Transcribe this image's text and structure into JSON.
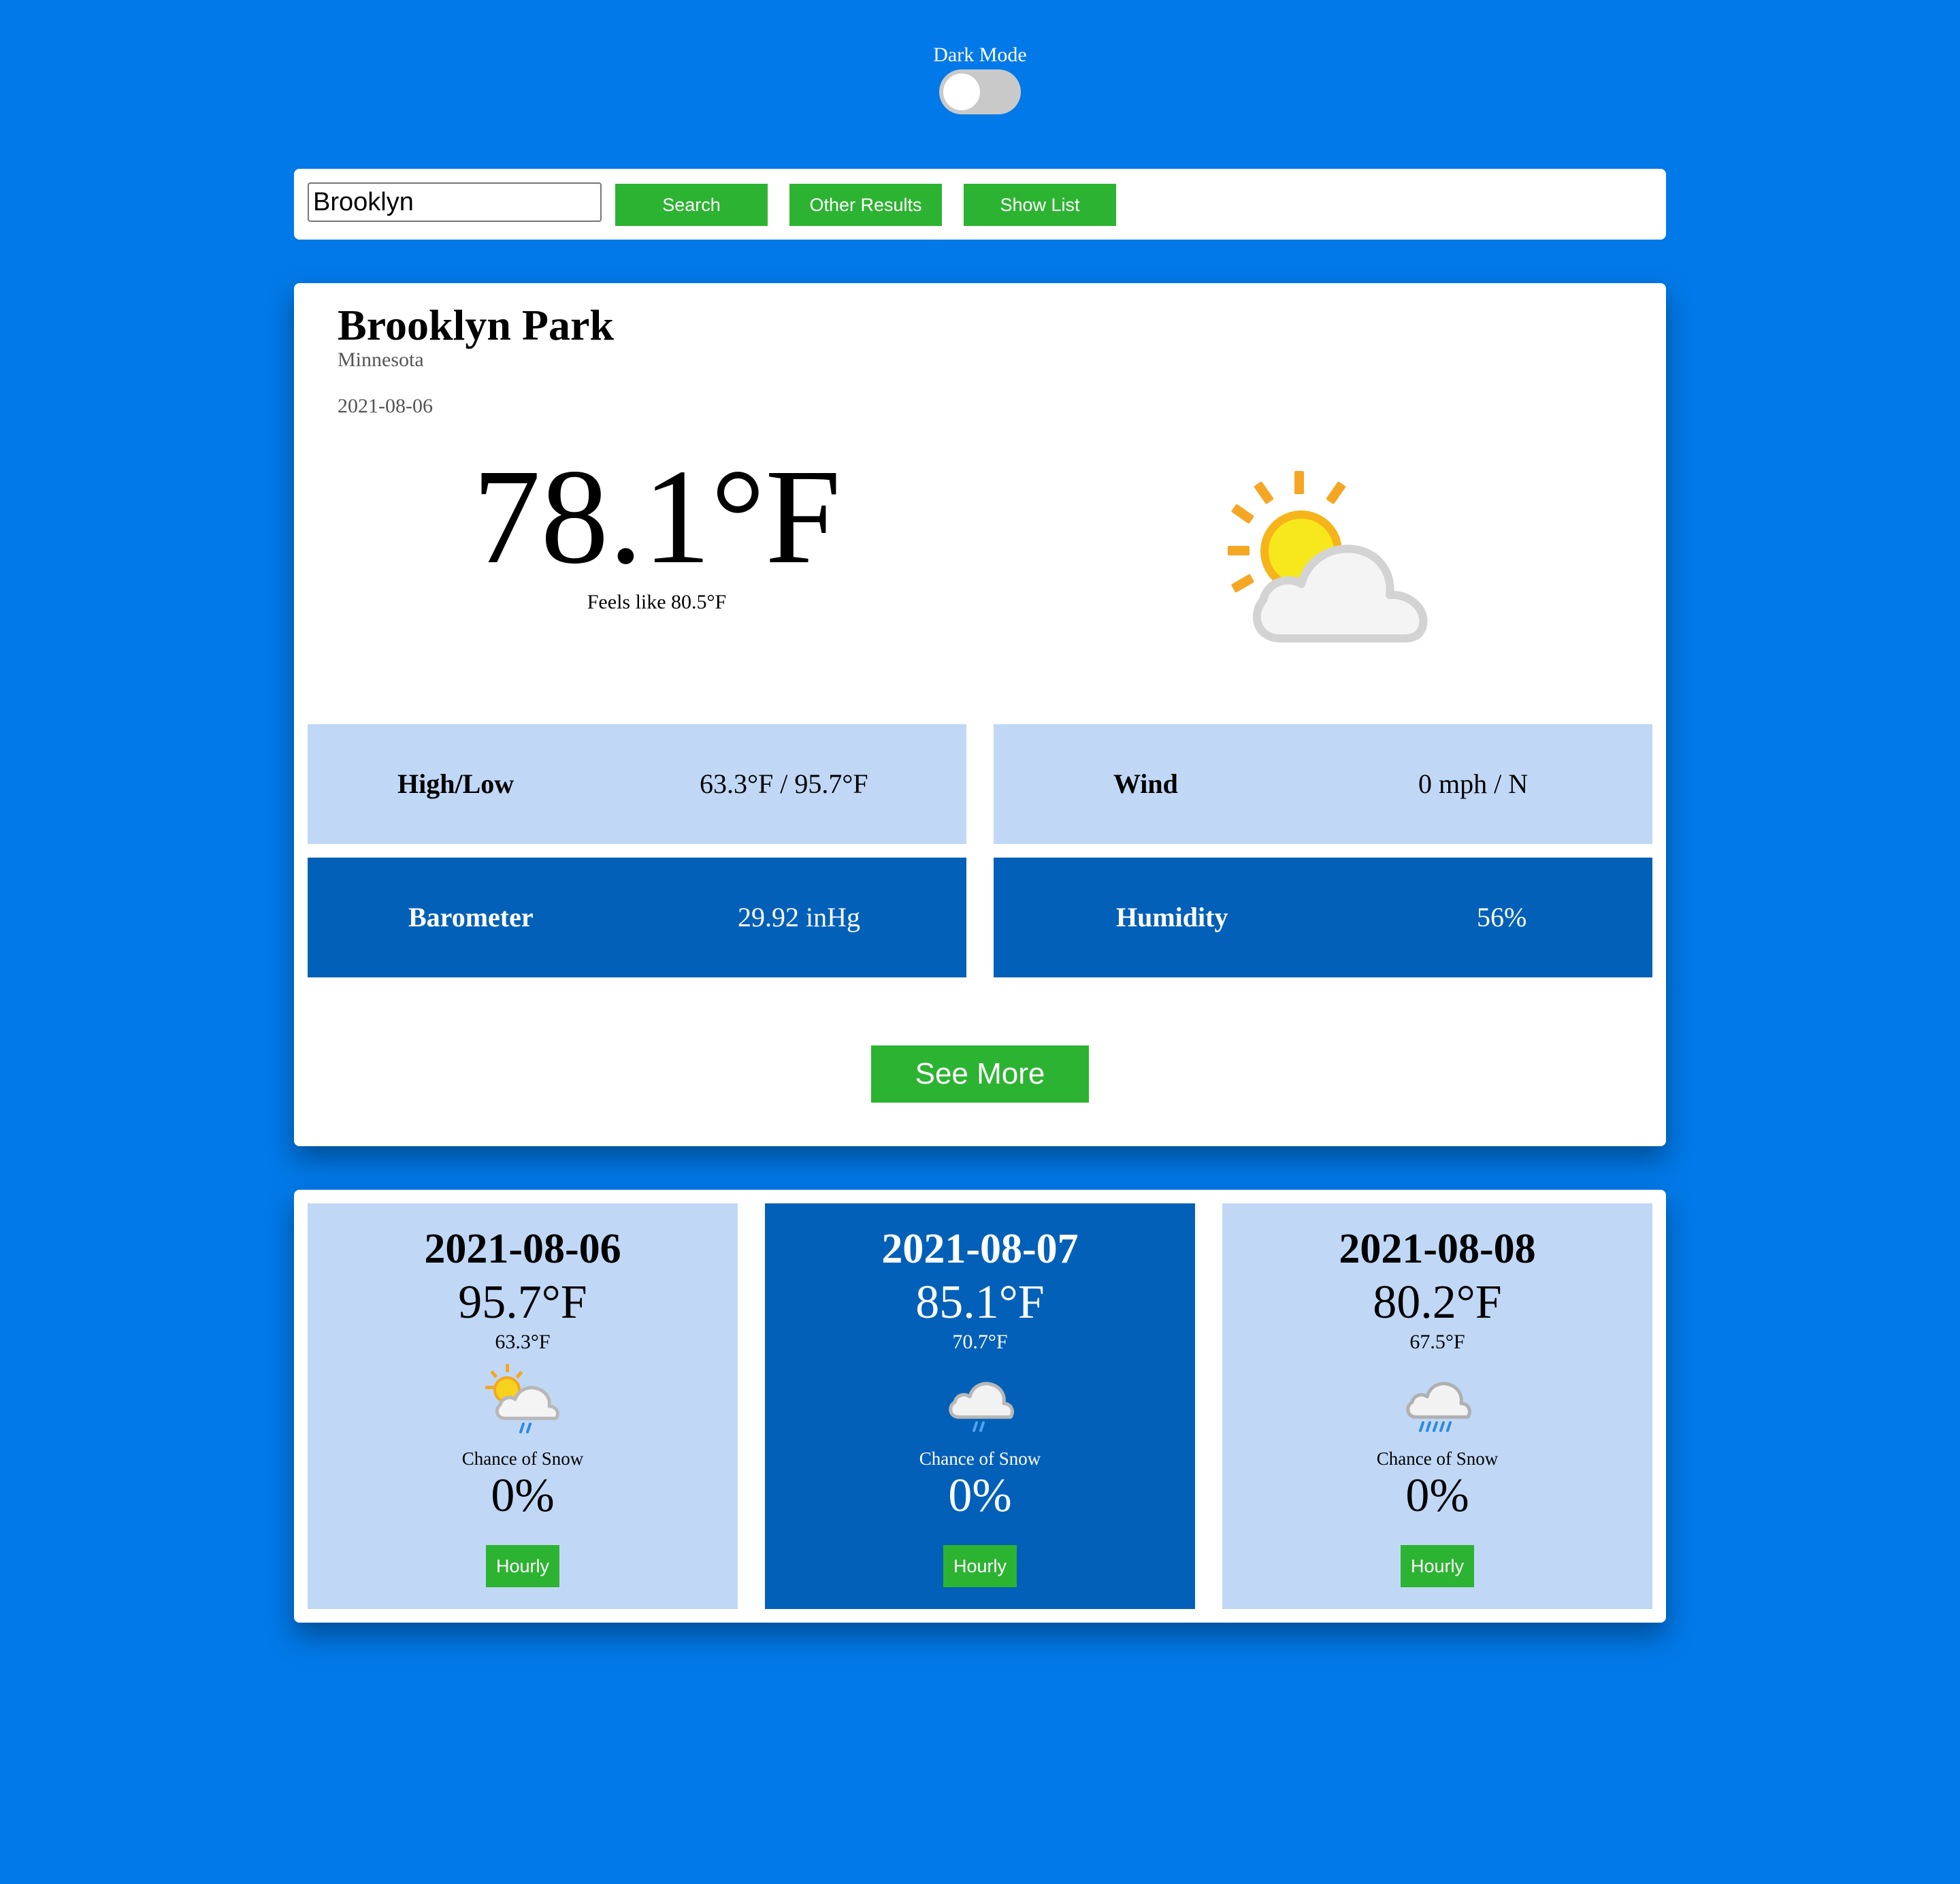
{
  "dark_mode": {
    "label": "Dark Mode",
    "enabled": false
  },
  "search": {
    "value": "Brooklyn",
    "search_label": "Search",
    "other_results_label": "Other Results",
    "show_list_label": "Show List"
  },
  "current": {
    "city": "Brooklyn Park",
    "region": "Minnesota",
    "date": "2021-08-06",
    "temperature": "78.1°F",
    "feels_like": "Feels like 80.5°F",
    "icon": "partly-cloudy-icon",
    "stats": [
      {
        "label": "High/Low",
        "value": "63.3°F / 95.7°F"
      },
      {
        "label": "Wind",
        "value": "0 mph / N"
      },
      {
        "label": "Barometer",
        "value": "29.92 inHg"
      },
      {
        "label": "Humidity",
        "value": "56%"
      }
    ],
    "see_more_label": "See More"
  },
  "forecast": [
    {
      "date": "2021-08-06",
      "high": "95.7°F",
      "low": "63.3°F",
      "icon": "sun-cloud-rain-icon",
      "chance_label": "Chance of Snow",
      "chance": "0%",
      "hourly_label": "Hourly"
    },
    {
      "date": "2021-08-07",
      "high": "85.1°F",
      "low": "70.7°F",
      "icon": "cloud-light-rain-icon",
      "chance_label": "Chance of Snow",
      "chance": "0%",
      "hourly_label": "Hourly"
    },
    {
      "date": "2021-08-08",
      "high": "80.2°F",
      "low": "67.5°F",
      "icon": "cloud-rain-icon",
      "chance_label": "Chance of Snow",
      "chance": "0%",
      "hourly_label": "Hourly"
    }
  ],
  "colors": {
    "background": "#0179e8",
    "button_green": "#2db332",
    "tile_light": "#c0d8f6",
    "tile_dark": "#0360b8"
  }
}
